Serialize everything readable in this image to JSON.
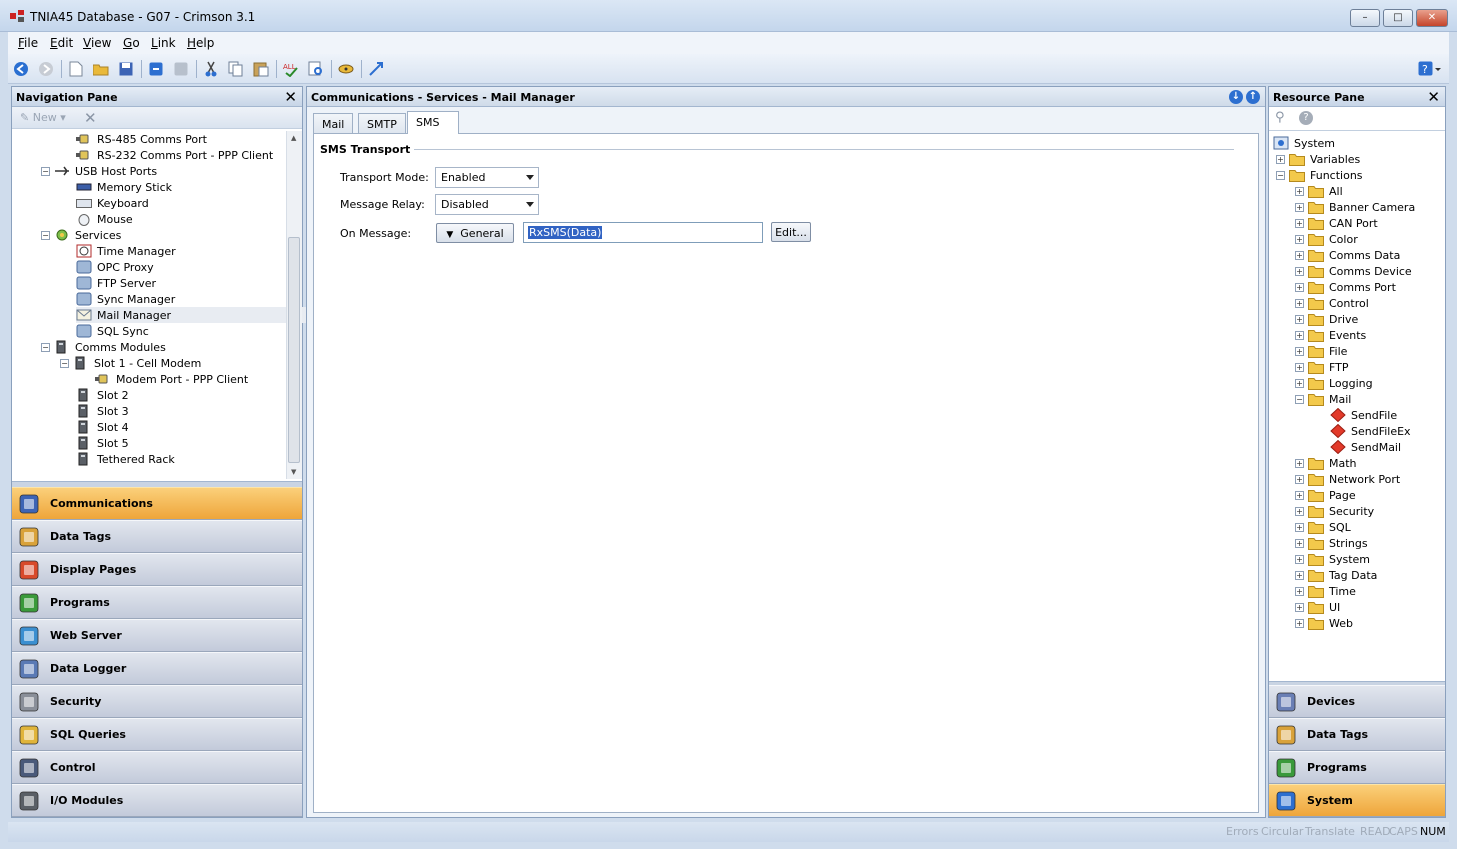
{
  "window": {
    "title": "TNIA45 Database - G07 - Crimson 3.1"
  },
  "menu": [
    "File",
    "Edit",
    "View",
    "Go",
    "Link",
    "Help"
  ],
  "nav": {
    "title": "Navigation Pane",
    "new_label": "New",
    "tree": [
      {
        "label": "RS-485 Comms Port",
        "indent": 2,
        "icon": "serial-port-icon"
      },
      {
        "label": "RS-232 Comms Port - PPP Client",
        "indent": 2,
        "icon": "serial-port-icon"
      },
      {
        "label": "USB Host Ports",
        "indent": 1,
        "icon": "usb-icon",
        "exp": "-"
      },
      {
        "label": "Memory Stick",
        "indent": 2,
        "icon": "memory-stick-icon"
      },
      {
        "label": "Keyboard",
        "indent": 2,
        "icon": "keyboard-icon"
      },
      {
        "label": "Mouse",
        "indent": 2,
        "icon": "mouse-icon"
      },
      {
        "label": "Services",
        "indent": 1,
        "icon": "services-icon",
        "exp": "-"
      },
      {
        "label": "Time Manager",
        "indent": 2,
        "icon": "clock-icon"
      },
      {
        "label": "OPC Proxy",
        "indent": 2,
        "icon": "opc-icon"
      },
      {
        "label": "FTP Server",
        "indent": 2,
        "icon": "ftp-icon"
      },
      {
        "label": "Sync Manager",
        "indent": 2,
        "icon": "sync-icon"
      },
      {
        "label": "Mail Manager",
        "indent": 2,
        "icon": "mail-icon",
        "selected": true
      },
      {
        "label": "SQL Sync",
        "indent": 2,
        "icon": "sql-sync-icon"
      },
      {
        "label": "Comms Modules",
        "indent": 1,
        "icon": "rack-icon",
        "exp": "-"
      },
      {
        "label": "Slot 1 - Cell Modem",
        "indent": 2,
        "icon": "slot-icon",
        "exp": "-"
      },
      {
        "label": "Modem Port - PPP Client",
        "indent": 3,
        "icon": "serial-port-icon"
      },
      {
        "label": "Slot 2",
        "indent": 2,
        "icon": "slot-icon"
      },
      {
        "label": "Slot 3",
        "indent": 2,
        "icon": "slot-icon"
      },
      {
        "label": "Slot 4",
        "indent": 2,
        "icon": "slot-icon"
      },
      {
        "label": "Slot 5",
        "indent": 2,
        "icon": "slot-icon"
      },
      {
        "label": "Tethered Rack",
        "indent": 2,
        "icon": "rack-icon"
      }
    ],
    "buttons": [
      {
        "label": "Communications",
        "icon": "communications-icon",
        "selected": true
      },
      {
        "label": "Data Tags",
        "icon": "data-tags-icon"
      },
      {
        "label": "Display Pages",
        "icon": "display-pages-icon"
      },
      {
        "label": "Programs",
        "icon": "programs-icon"
      },
      {
        "label": "Web Server",
        "icon": "web-server-icon"
      },
      {
        "label": "Data Logger",
        "icon": "data-logger-icon"
      },
      {
        "label": "Security",
        "icon": "security-icon"
      },
      {
        "label": "SQL Queries",
        "icon": "sql-queries-icon"
      },
      {
        "label": "Control",
        "icon": "control-icon"
      },
      {
        "label": "I/O Modules",
        "icon": "io-modules-icon"
      }
    ]
  },
  "center": {
    "title": "Communications - Services - Mail Manager",
    "tabs": [
      "Mail",
      "SMTP",
      "SMS"
    ],
    "active_tab": "SMS",
    "section": "SMS Transport",
    "transport_label": "Transport Mode:",
    "transport_value": "Enabled",
    "relay_label": "Message Relay:",
    "relay_value": "Disabled",
    "onmsg_label": "On Message:",
    "onmsg_type": "General",
    "onmsg_value": "RxSMS(Data)",
    "edit_button": "Edit..."
  },
  "res": {
    "title": "Resource Pane",
    "tree": [
      {
        "label": "System",
        "indent": 0,
        "icon": "system-icon"
      },
      {
        "label": "Variables",
        "indent": 1,
        "icon": "folder-icon",
        "exp": "+"
      },
      {
        "label": "Functions",
        "indent": 1,
        "icon": "folder-icon",
        "exp": "-"
      },
      {
        "label": "All",
        "indent": 2,
        "icon": "folder-icon",
        "exp": "+"
      },
      {
        "label": "Banner Camera",
        "indent": 2,
        "icon": "folder-icon",
        "exp": "+"
      },
      {
        "label": "CAN Port",
        "indent": 2,
        "icon": "folder-icon",
        "exp": "+"
      },
      {
        "label": "Color",
        "indent": 2,
        "icon": "folder-icon",
        "exp": "+"
      },
      {
        "label": "Comms Data",
        "indent": 2,
        "icon": "folder-icon",
        "exp": "+"
      },
      {
        "label": "Comms Device",
        "indent": 2,
        "icon": "folder-icon",
        "exp": "+"
      },
      {
        "label": "Comms Port",
        "indent": 2,
        "icon": "folder-icon",
        "exp": "+"
      },
      {
        "label": "Control",
        "indent": 2,
        "icon": "folder-icon",
        "exp": "+"
      },
      {
        "label": "Drive",
        "indent": 2,
        "icon": "folder-icon",
        "exp": "+"
      },
      {
        "label": "Events",
        "indent": 2,
        "icon": "folder-icon",
        "exp": "+"
      },
      {
        "label": "File",
        "indent": 2,
        "icon": "folder-icon",
        "exp": "+"
      },
      {
        "label": "FTP",
        "indent": 2,
        "icon": "folder-icon",
        "exp": "+"
      },
      {
        "label": "Logging",
        "indent": 2,
        "icon": "folder-icon",
        "exp": "+"
      },
      {
        "label": "Mail",
        "indent": 2,
        "icon": "folder-icon",
        "exp": "-"
      },
      {
        "label": "SendFile",
        "indent": 3,
        "icon": "function-icon"
      },
      {
        "label": "SendFileEx",
        "indent": 3,
        "icon": "function-icon"
      },
      {
        "label": "SendMail",
        "indent": 3,
        "icon": "function-icon"
      },
      {
        "label": "Math",
        "indent": 2,
        "icon": "folder-icon",
        "exp": "+"
      },
      {
        "label": "Network Port",
        "indent": 2,
        "icon": "folder-icon",
        "exp": "+"
      },
      {
        "label": "Page",
        "indent": 2,
        "icon": "folder-icon",
        "exp": "+"
      },
      {
        "label": "Security",
        "indent": 2,
        "icon": "folder-icon",
        "exp": "+"
      },
      {
        "label": "SQL",
        "indent": 2,
        "icon": "folder-icon",
        "exp": "+"
      },
      {
        "label": "Strings",
        "indent": 2,
        "icon": "folder-icon",
        "exp": "+"
      },
      {
        "label": "System",
        "indent": 2,
        "icon": "folder-icon",
        "exp": "+"
      },
      {
        "label": "Tag Data",
        "indent": 2,
        "icon": "folder-icon",
        "exp": "+"
      },
      {
        "label": "Time",
        "indent": 2,
        "icon": "folder-icon",
        "exp": "+"
      },
      {
        "label": "UI",
        "indent": 2,
        "icon": "folder-icon",
        "exp": "+"
      },
      {
        "label": "Web",
        "indent": 2,
        "icon": "folder-icon",
        "exp": "+"
      }
    ],
    "buttons": [
      {
        "label": "Devices",
        "icon": "devices-icon"
      },
      {
        "label": "Data Tags",
        "icon": "data-tags-icon"
      },
      {
        "label": "Programs",
        "icon": "programs-icon"
      },
      {
        "label": "System",
        "icon": "system-icon",
        "selected": true
      }
    ]
  },
  "status": [
    "Errors",
    "Circular",
    "Translate",
    "READ",
    "CAPS",
    "NUM"
  ],
  "colors": {
    "selected_nav": "#f0a83e",
    "folder": "#f3c94b",
    "function": "#e23a2a"
  }
}
